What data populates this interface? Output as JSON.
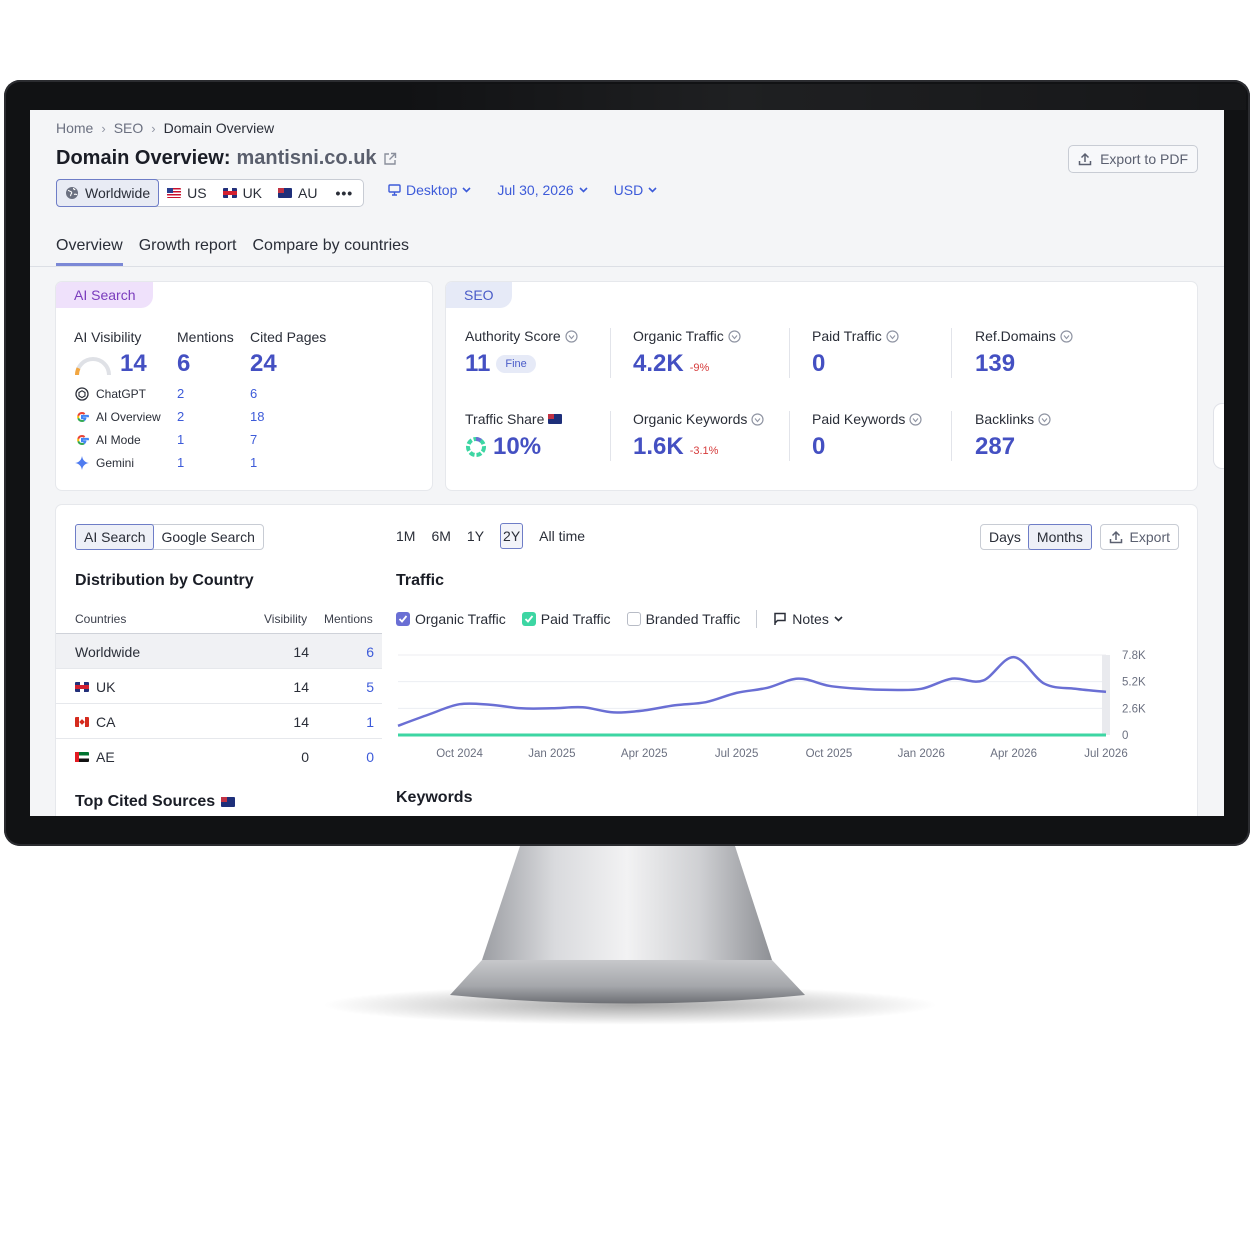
{
  "breadcrumb": [
    "Home",
    "SEO",
    "Domain Overview"
  ],
  "page_title": {
    "prefix": "Domain Overview:",
    "domain": "mantisni.co.uk"
  },
  "export_pdf_label": "Export to PDF",
  "databases": [
    {
      "label": "Worldwide",
      "icon": "globe-icon",
      "selected": true
    },
    {
      "label": "US",
      "icon": "flag-us"
    },
    {
      "label": "UK",
      "icon": "flag-uk"
    },
    {
      "label": "AU",
      "icon": "flag-au"
    }
  ],
  "more_label": "•••",
  "filters": {
    "device": "Desktop",
    "date": "Jul 30, 2026",
    "currency": "USD"
  },
  "tabs": [
    "Overview",
    "Growth report",
    "Compare by countries"
  ],
  "ai_card": {
    "tag": "AI Search",
    "headers": {
      "visibility": "AI Visibility",
      "mentions": "Mentions",
      "cited": "Cited Pages"
    },
    "visibility": "14",
    "mentions": "6",
    "cited": "24",
    "visibility_gauge_fraction": 0.14,
    "sources": [
      {
        "name": "ChatGPT",
        "icon": "chatgpt-icon",
        "mentions": "2",
        "cited": "6"
      },
      {
        "name": "AI Overview",
        "icon": "google-icon",
        "mentions": "2",
        "cited": "18"
      },
      {
        "name": "AI Mode",
        "icon": "google-icon",
        "mentions": "1",
        "cited": "7"
      },
      {
        "name": "Gemini",
        "icon": "gemini-icon",
        "mentions": "1",
        "cited": "1"
      }
    ]
  },
  "seo_card": {
    "tag": "SEO",
    "authority": {
      "label": "Authority Score",
      "value": "11",
      "badge": "Fine"
    },
    "organic_traffic": {
      "label": "Organic Traffic",
      "value": "4.2K",
      "change": "-9%"
    },
    "paid_traffic": {
      "label": "Paid Traffic",
      "value": "0"
    },
    "ref_domains": {
      "label": "Ref.Domains",
      "value": "139"
    },
    "traffic_share": {
      "label": "Traffic Share",
      "value": "10%",
      "flag": "flag-au"
    },
    "organic_keywords": {
      "label": "Organic Keywords",
      "value": "1.6K",
      "change": "-3.1%"
    },
    "paid_keywords": {
      "label": "Paid Keywords",
      "value": "0"
    },
    "backlinks": {
      "label": "Backlinks",
      "value": "287"
    }
  },
  "bottom": {
    "search_toggle": [
      "AI Search",
      "Google Search"
    ],
    "distribution_title": "Distribution by Country",
    "table_headers": {
      "countries": "Countries",
      "visibility": "Visibility",
      "mentions": "Mentions"
    },
    "rows": [
      {
        "country": "Worldwide",
        "flag": "",
        "visibility": "14",
        "mentions": "6"
      },
      {
        "country": "UK",
        "flag": "flag-uk",
        "visibility": "14",
        "mentions": "5"
      },
      {
        "country": "CA",
        "flag": "flag-ca",
        "visibility": "14",
        "mentions": "1"
      },
      {
        "country": "AE",
        "flag": "flag-ae",
        "visibility": "0",
        "mentions": "0"
      }
    ],
    "top_cited_title": "Top Cited Sources",
    "ranges": [
      "1M",
      "6M",
      "1Y",
      "2Y",
      "All time"
    ],
    "range_selected": "2Y",
    "granularity": [
      "Days",
      "Months"
    ],
    "granularity_selected": "Months",
    "export_label": "Export",
    "traffic_title": "Traffic",
    "legend": {
      "organic": "Organic Traffic",
      "paid": "Paid Traffic",
      "branded": "Branded Traffic",
      "notes": "Notes"
    },
    "keywords_title": "Keywords"
  },
  "colors": {
    "organic": "#6a6fd4",
    "paid": "#3dd6a3",
    "accent": "#4450c2",
    "negative": "#d63b3b"
  },
  "chart_data": {
    "type": "line",
    "title": "Traffic",
    "x": [
      "2024-08",
      "2024-09",
      "2024-10",
      "2024-11",
      "2024-12",
      "2025-01",
      "2025-02",
      "2025-03",
      "2025-04",
      "2025-05",
      "2025-06",
      "2025-07",
      "2025-08",
      "2025-09",
      "2025-10",
      "2025-11",
      "2025-12",
      "2026-01",
      "2026-02",
      "2026-03",
      "2026-04",
      "2026-05",
      "2026-06",
      "2026-07"
    ],
    "x_tick_labels": [
      "Oct 2024",
      "Jan 2025",
      "Apr 2025",
      "Jul 2025",
      "Oct 2025",
      "Jan 2026",
      "Apr 2026",
      "Jul 2026"
    ],
    "y_tick_labels": [
      "7.8K",
      "5.2K",
      "2.6K",
      "0"
    ],
    "ylim": [
      0,
      7800
    ],
    "series": [
      {
        "name": "Organic Traffic",
        "values": [
          900,
          2000,
          3000,
          2950,
          2600,
          2600,
          2700,
          2200,
          2400,
          2900,
          3200,
          4100,
          4600,
          5500,
          4800,
          4500,
          4400,
          4500,
          5500,
          5300,
          7600,
          5000,
          4500,
          4200
        ]
      },
      {
        "name": "Paid Traffic",
        "values": [
          0,
          0,
          0,
          0,
          0,
          0,
          0,
          0,
          0,
          0,
          0,
          0,
          0,
          0,
          0,
          0,
          0,
          0,
          0,
          0,
          0,
          0,
          0,
          0
        ]
      }
    ],
    "grid": true
  }
}
